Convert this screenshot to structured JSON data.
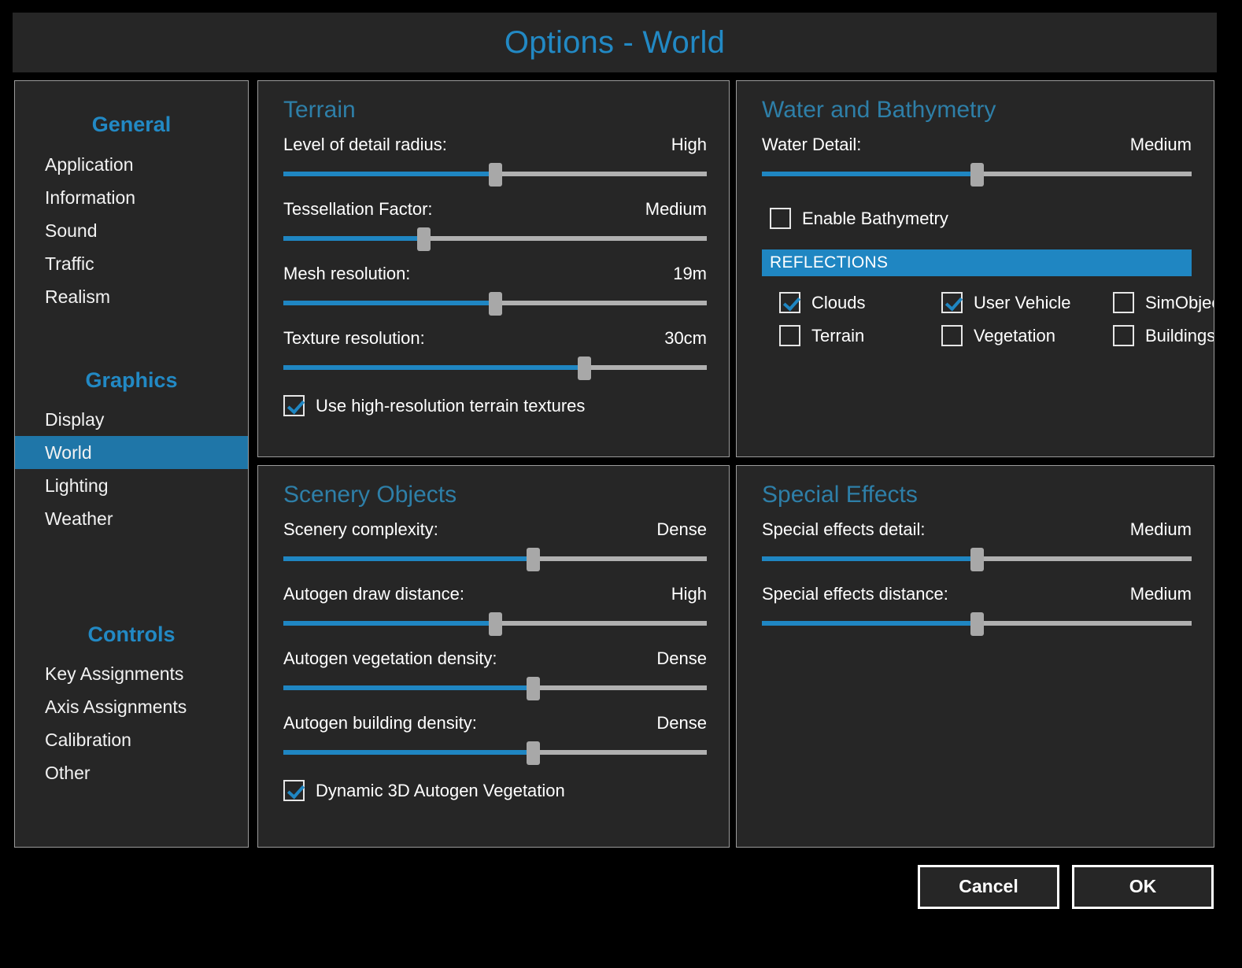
{
  "window": {
    "title": "Options - World",
    "accent_color": "#2289c4",
    "panel_bg": "#262626",
    "slider_fill_color": "#1f86c2",
    "slider_track_color": "#b0b0b0",
    "thumb_color": "#a8a8a8"
  },
  "sidebar": {
    "groups": [
      {
        "title": "General",
        "items": [
          {
            "label": "Application",
            "selected": false
          },
          {
            "label": "Information",
            "selected": false
          },
          {
            "label": "Sound",
            "selected": false
          },
          {
            "label": "Traffic",
            "selected": false
          },
          {
            "label": "Realism",
            "selected": false
          }
        ]
      },
      {
        "title": "Graphics",
        "items": [
          {
            "label": "Display",
            "selected": false
          },
          {
            "label": "World",
            "selected": true
          },
          {
            "label": "Lighting",
            "selected": false
          },
          {
            "label": "Weather",
            "selected": false
          }
        ]
      },
      {
        "title": "Controls",
        "items": [
          {
            "label": "Key Assignments",
            "selected": false
          },
          {
            "label": "Axis Assignments",
            "selected": false
          },
          {
            "label": "Calibration",
            "selected": false
          },
          {
            "label": "Other",
            "selected": false
          }
        ]
      }
    ]
  },
  "panels": {
    "terrain": {
      "title": "Terrain",
      "sliders": [
        {
          "label": "Level of detail radius:",
          "value": "High",
          "percent": 50
        },
        {
          "label": "Tessellation Factor:",
          "value": "Medium",
          "percent": 33
        },
        {
          "label": "Mesh resolution:",
          "value": "19m",
          "percent": 50
        },
        {
          "label": "Texture resolution:",
          "value": "30cm",
          "percent": 71
        }
      ],
      "checkbox": {
        "label": "Use high-resolution terrain textures",
        "checked": true
      }
    },
    "water": {
      "title": "Water and Bathymetry",
      "sliders": [
        {
          "label": "Water Detail:",
          "value": "Medium",
          "percent": 50
        }
      ],
      "checkbox": {
        "label": "Enable Bathymetry",
        "checked": false
      },
      "reflections_header": "REFLECTIONS",
      "reflections": [
        {
          "label": "Clouds",
          "checked": true
        },
        {
          "label": "User Vehicle",
          "checked": true
        },
        {
          "label": "SimObjects",
          "checked": false
        },
        {
          "label": "Terrain",
          "checked": false
        },
        {
          "label": "Vegetation",
          "checked": false
        },
        {
          "label": "Buildings",
          "checked": false
        }
      ]
    },
    "scenery": {
      "title": "Scenery Objects",
      "sliders": [
        {
          "label": "Scenery complexity:",
          "value": "Dense",
          "percent": 59
        },
        {
          "label": "Autogen draw distance:",
          "value": "High",
          "percent": 50
        },
        {
          "label": "Autogen vegetation density:",
          "value": "Dense",
          "percent": 59
        },
        {
          "label": "Autogen building density:",
          "value": "Dense",
          "percent": 59
        }
      ],
      "checkbox": {
        "label": "Dynamic 3D Autogen Vegetation",
        "checked": true
      }
    },
    "effects": {
      "title": "Special Effects",
      "sliders": [
        {
          "label": "Special effects detail:",
          "value": "Medium",
          "percent": 50
        },
        {
          "label": "Special effects distance:",
          "value": "Medium",
          "percent": 50
        }
      ]
    }
  },
  "footer": {
    "cancel_label": "Cancel",
    "ok_label": "OK"
  }
}
